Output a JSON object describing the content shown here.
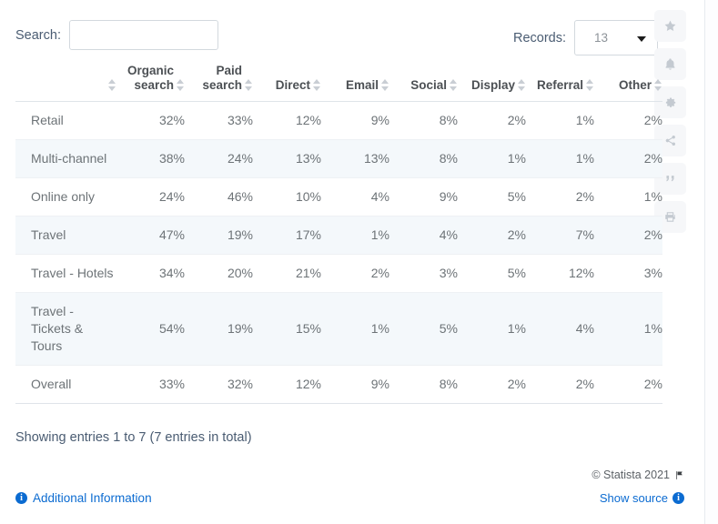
{
  "search": {
    "label": "Search:",
    "value": "",
    "placeholder": ""
  },
  "records": {
    "label": "Records:",
    "value": "13",
    "caret_icon": "chevron-down-icon"
  },
  "icon_rail": [
    {
      "name": "star-icon",
      "label": "Favorite"
    },
    {
      "name": "bell-icon",
      "label": "Notifications"
    },
    {
      "name": "gear-icon",
      "label": "Settings"
    },
    {
      "name": "share-icon",
      "label": "Share"
    },
    {
      "name": "quote-icon",
      "label": "Cite"
    },
    {
      "name": "print-icon",
      "label": "Print"
    }
  ],
  "table": {
    "columns": [
      {
        "label": "",
        "sortable": true,
        "type": "category"
      },
      {
        "label": "Organic search",
        "sortable": true,
        "type": "number"
      },
      {
        "label": "Paid search",
        "sortable": true,
        "type": "number"
      },
      {
        "label": "Direct",
        "sortable": true,
        "type": "number"
      },
      {
        "label": "Email",
        "sortable": true,
        "type": "number"
      },
      {
        "label": "Social",
        "sortable": true,
        "type": "number"
      },
      {
        "label": "Display",
        "sortable": true,
        "type": "number"
      },
      {
        "label": "Referral",
        "sortable": true,
        "type": "number"
      },
      {
        "label": "Other",
        "sortable": true,
        "type": "number"
      }
    ],
    "rows": [
      {
        "category": "Retail",
        "values": [
          "32%",
          "33%",
          "12%",
          "9%",
          "8%",
          "2%",
          "1%",
          "2%"
        ]
      },
      {
        "category": "Multi-channel",
        "values": [
          "38%",
          "24%",
          "13%",
          "13%",
          "8%",
          "1%",
          "1%",
          "2%"
        ]
      },
      {
        "category": "Online only",
        "values": [
          "24%",
          "46%",
          "10%",
          "4%",
          "9%",
          "5%",
          "2%",
          "1%"
        ]
      },
      {
        "category": "Travel",
        "values": [
          "47%",
          "19%",
          "17%",
          "1%",
          "4%",
          "2%",
          "7%",
          "2%"
        ]
      },
      {
        "category": "Travel - Hotels",
        "values": [
          "34%",
          "20%",
          "21%",
          "2%",
          "3%",
          "5%",
          "12%",
          "3%"
        ]
      },
      {
        "category": "Travel - Tickets & Tours",
        "values": [
          "54%",
          "19%",
          "15%",
          "1%",
          "5%",
          "1%",
          "4%",
          "1%"
        ]
      },
      {
        "category": "Overall",
        "values": [
          "33%",
          "32%",
          "12%",
          "9%",
          "8%",
          "2%",
          "2%",
          "2%"
        ]
      }
    ]
  },
  "footer": {
    "showing_entries": "Showing entries 1 to 7 (7 entries in total)",
    "additional_information": "Additional Information",
    "additional_information_icon": "info-icon",
    "copyright": "© Statista 2021",
    "copyright_flag_icon": "flag-icon",
    "show_source": "Show source",
    "show_source_icon": "info-icon"
  },
  "colors": {
    "link": "#0b6bd1",
    "label_text": "#4a5c72",
    "body_text": "#6d7377",
    "header_text": "#4c5054",
    "row_alt_bg": "#f4f8fb",
    "border": "#dfe4e9",
    "rail_bg": "#f6f7f9",
    "rail_icon": "#c4cad1"
  }
}
